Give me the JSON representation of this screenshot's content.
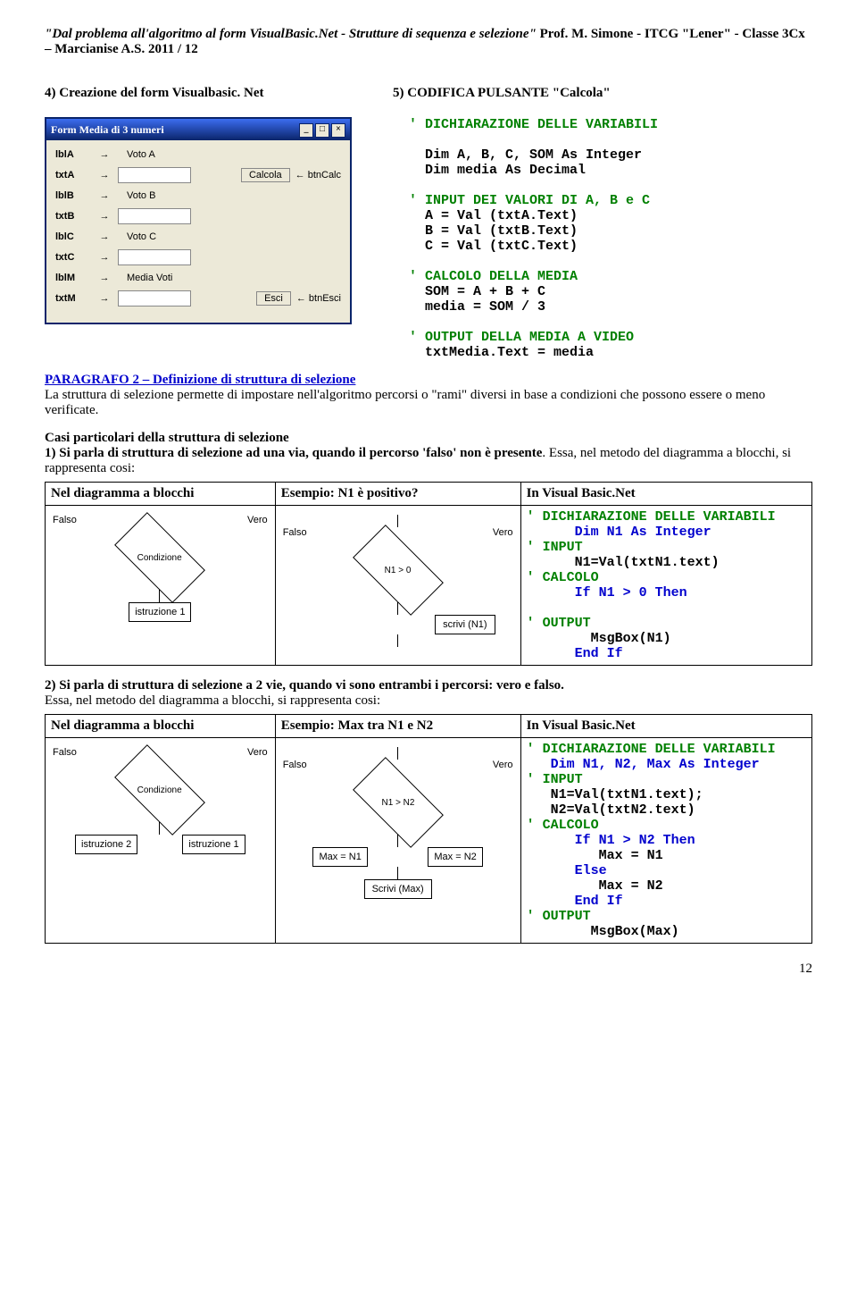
{
  "header": {
    "title": "\"Dal problema all'algoritmo al form VisualBasic.Net - Strutture di sequenza e selezione\"",
    "prof": "Prof.  M.  Simone  - ITCG \"Lener\"  - Classe 3Cx – Marcianise A.S. 2011 / 12"
  },
  "sec4": "4) Creazione del form Visualbasic. Net",
  "sec5": "5)  CODIFICA PULSANTE \"Calcola\"",
  "form": {
    "title": "Form Media di 3 numeri",
    "rows": [
      {
        "lbl": "lblA",
        "desc": "Voto A"
      },
      {
        "lbl": "txtA",
        "desc": ""
      },
      {
        "lbl": "lblB",
        "desc": "Voto B"
      },
      {
        "lbl": "txtB",
        "desc": ""
      },
      {
        "lbl": "lblC",
        "desc": "Voto C"
      },
      {
        "lbl": "txtC",
        "desc": ""
      },
      {
        "lbl": "lblM",
        "desc": "Media Voti"
      },
      {
        "lbl": "txtM",
        "desc": ""
      }
    ],
    "btnCalc": "Calcola",
    "btnCalcAnnot": "btnCalc",
    "btnEsci": "Esci",
    "btnEsciAnnot": "btnEsci"
  },
  "code1": {
    "c1": "' DICHIARAZIONE DELLE VARIABILI",
    "l1": "Dim A, B, C, SOM As Integer",
    "l2": "Dim media As Decimal",
    "c2": "' INPUT DEI VALORI DI A, B e C",
    "l3": "A = Val (txtA.Text)",
    "l4": "B = Val (txtB.Text)",
    "l5": "C = Val (txtC.Text)",
    "c3": "' CALCOLO DELLA MEDIA",
    "l6": "SOM = A + B + C",
    "l7": "media = SOM / 3",
    "c4": "' OUTPUT DELLA MEDIA A VIDEO",
    "l8": "txtMedia.Text = media"
  },
  "para2": {
    "title": "PARAGRAFO 2 – Definizione di struttura di selezione",
    "body": "La struttura di selezione permette di impostare nell'algoritmo percorsi o \"rami\" diversi in base a condizioni che possono essere o meno verificate."
  },
  "casi": {
    "title": "Casi particolari della struttura di selezione",
    "p1a": "1) Si parla di struttura di selezione ad una via, quando il percorso 'falso' non è presente",
    "p1b": ". Essa, nel metodo del diagramma a blocchi, si rappresenta cosi:"
  },
  "tab1": {
    "h1": "Nel diagramma a blocchi",
    "h2": "Esempio: N1 è positivo?",
    "h3": "In Visual Basic.Net",
    "d1": {
      "cond": "Condizione",
      "false": "Falso",
      "true": "Vero",
      "istr": "istruzione  1"
    },
    "d2": {
      "cond": "N1 > 0",
      "false": "Falso",
      "true": "Vero",
      "scrivi": "scrivi (N1)"
    },
    "code": {
      "c1": "' DICHIARAZIONE DELLE VARIABILI",
      "l1": "Dim N1 As Integer",
      "c2": "' INPUT",
      "l2": "N1=Val(txtN1.text)",
      "c3": "' CALCOLO",
      "l3": "If N1 > 0 Then",
      "c4": "' OUTPUT",
      "l4": "MsgBox(N1)",
      "l5": "End If"
    }
  },
  "p2": {
    "bold": "2) Si parla di struttura  di selezione a 2 vie, quando vi sono entrambi i percorsi: vero e falso.",
    "rest": "Essa, nel metodo del diagramma a blocchi, si rappresenta cosi:"
  },
  "tab2": {
    "h1": "Nel diagramma a blocchi",
    "h2": "Esempio: Max tra N1 e N2",
    "h3": "In Visual Basic.Net",
    "d1": {
      "cond": "Condizione",
      "false": "Falso",
      "true": "Vero",
      "i1": "istruzione  2",
      "i2": "istruzione  1"
    },
    "d2": {
      "cond": "N1 > N2",
      "false": "Falso",
      "true": "Vero",
      "m1": "Max = N1",
      "m2": "Max = N2",
      "scrivi": "Scrivi (Max)"
    },
    "code": {
      "c1": "' DICHIARAZIONE DELLE VARIABILI",
      "l1": "Dim N1, N2, Max As Integer",
      "c2": "' INPUT",
      "l2": "N1=Val(txtN1.text);",
      "l3": "N2=Val(txtN2.text)",
      "c3": "' CALCOLO",
      "l4": "If N1 > N2 Then",
      "l5": "Max = N1",
      "l6": "Else",
      "l7": "Max = N2",
      "l8": "End If",
      "c4": "' OUTPUT",
      "l9": "MsgBox(Max)"
    }
  },
  "page": "12"
}
